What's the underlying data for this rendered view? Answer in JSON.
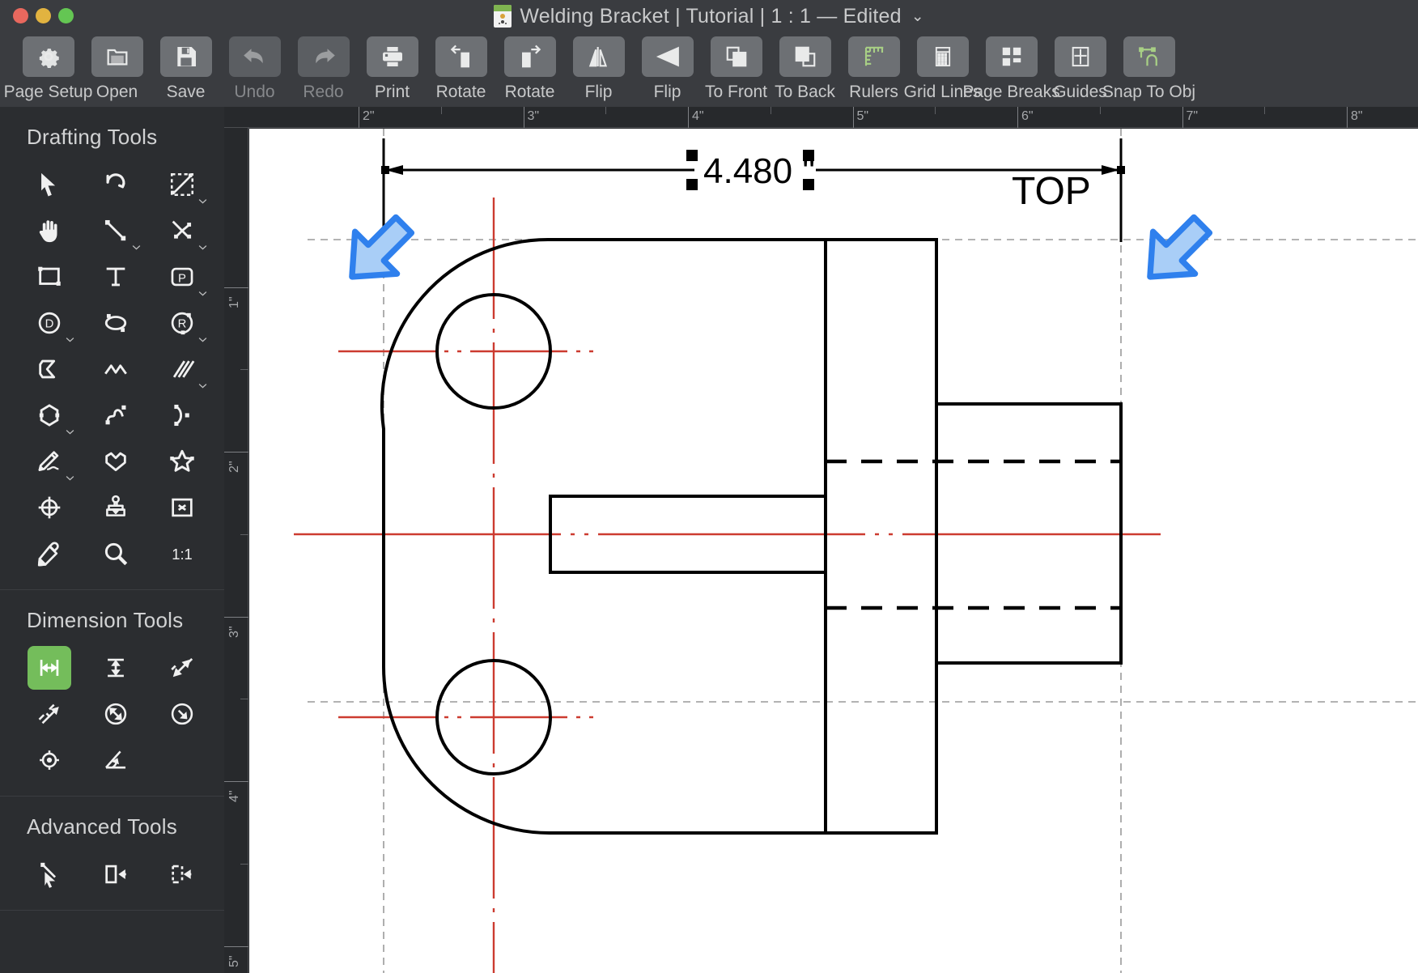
{
  "window": {
    "title": "Welding Bracket | Tutorial | 1 : 1 — Edited",
    "chevron": "⌄",
    "traffic_lights": [
      "close",
      "minimize",
      "zoom"
    ]
  },
  "toolbar": {
    "items": [
      {
        "label": "Page Setup",
        "icon": "gear-icon",
        "disabled": false
      },
      {
        "label": "Open",
        "icon": "folder-icon",
        "disabled": false
      },
      {
        "label": "Save",
        "icon": "floppy-disk-icon",
        "disabled": false
      },
      {
        "label": "Undo",
        "icon": "undo-arrow-icon",
        "disabled": true
      },
      {
        "label": "Redo",
        "icon": "redo-arrow-icon",
        "disabled": true
      },
      {
        "label": "Print",
        "icon": "printer-icon",
        "disabled": false
      },
      {
        "label": "Rotate",
        "icon": "rotate-left-icon",
        "disabled": false
      },
      {
        "label": "Rotate",
        "icon": "rotate-right-icon",
        "disabled": false
      },
      {
        "label": "Flip",
        "icon": "flip-vertical-icon",
        "disabled": false
      },
      {
        "label": "Flip",
        "icon": "flip-horizontal-icon",
        "disabled": false
      },
      {
        "label": "To Front",
        "icon": "bring-to-front-icon",
        "disabled": false
      },
      {
        "label": "To Back",
        "icon": "send-to-back-icon",
        "disabled": false
      },
      {
        "label": "Rulers",
        "icon": "ruler-icon",
        "disabled": false
      },
      {
        "label": "Grid Lines",
        "icon": "grid-lines-icon",
        "disabled": false
      },
      {
        "label": "Page Breaks",
        "icon": "page-breaks-icon",
        "disabled": false
      },
      {
        "label": "Guides",
        "icon": "guides-icon",
        "disabled": false
      },
      {
        "label": "Snap To Obj",
        "icon": "snap-to-object-icon",
        "disabled": false
      }
    ],
    "accent_green": "#a8cf85"
  },
  "sidebar": {
    "sections": [
      {
        "title": "Drafting Tools",
        "tools": [
          {
            "name": "select-arrow-tool",
            "caret": false,
            "active": false
          },
          {
            "name": "rotate-tool",
            "caret": false,
            "active": false
          },
          {
            "name": "scale-selection-tool",
            "caret": true,
            "active": false
          },
          {
            "name": "pan-hand-tool",
            "caret": false,
            "active": false
          },
          {
            "name": "line-tool",
            "caret": true,
            "active": false
          },
          {
            "name": "polyline-tool",
            "caret": true,
            "active": false
          },
          {
            "name": "rectangle-tool",
            "caret": false,
            "active": false
          },
          {
            "name": "text-tool",
            "caret": false,
            "active": false
          },
          {
            "name": "point-label-tool",
            "caret": true,
            "active": false
          },
          {
            "name": "diameter-circle-tool",
            "caret": true,
            "active": false
          },
          {
            "name": "ellipse-tool",
            "caret": false,
            "active": false
          },
          {
            "name": "radius-arc-tool",
            "caret": true,
            "active": false
          },
          {
            "name": "chamfer-tool",
            "caret": false,
            "active": false
          },
          {
            "name": "zigzag-tool",
            "caret": false,
            "active": false
          },
          {
            "name": "parallel-lines-tool",
            "caret": true,
            "active": false
          },
          {
            "name": "polygon-tool",
            "caret": true,
            "active": false
          },
          {
            "name": "spline-tool",
            "caret": false,
            "active": false
          },
          {
            "name": "arc-tool",
            "caret": false,
            "active": false
          },
          {
            "name": "freehand-pencil-tool",
            "caret": true,
            "active": false
          },
          {
            "name": "heart-shape-tool",
            "caret": false,
            "active": false
          },
          {
            "name": "star-shape-tool",
            "caret": false,
            "active": false
          },
          {
            "name": "center-mark-tool",
            "caret": false,
            "active": false
          },
          {
            "name": "stamp-tool",
            "caret": false,
            "active": false
          },
          {
            "name": "delete-tool",
            "caret": false,
            "active": false
          },
          {
            "name": "eyedropper-tool",
            "caret": false,
            "active": false
          },
          {
            "name": "zoom-tool",
            "caret": false,
            "active": false
          },
          {
            "name": "actual-size-tool",
            "caret": false,
            "active": false,
            "text": "1:1"
          }
        ]
      },
      {
        "title": "Dimension Tools",
        "tools": [
          {
            "name": "horizontal-dimension-tool",
            "caret": false,
            "active": true
          },
          {
            "name": "vertical-dimension-tool",
            "caret": false,
            "active": false
          },
          {
            "name": "aligned-dimension-tool",
            "caret": false,
            "active": false
          },
          {
            "name": "baseline-dimension-tool",
            "caret": false,
            "active": false
          },
          {
            "name": "diameter-dimension-tool",
            "caret": false,
            "active": false
          },
          {
            "name": "radius-dimension-tool",
            "caret": false,
            "active": false
          },
          {
            "name": "center-mark-dimension-tool",
            "caret": false,
            "active": false
          },
          {
            "name": "angular-dimension-tool",
            "caret": false,
            "active": false
          }
        ]
      },
      {
        "title": "Advanced Tools",
        "tools": [
          {
            "name": "node-edit-tool",
            "caret": false,
            "active": false
          },
          {
            "name": "align-left-tool",
            "caret": false,
            "active": false
          },
          {
            "name": "distribute-tool",
            "caret": false,
            "active": false
          }
        ]
      }
    ],
    "active_color": "#74bd5b"
  },
  "rulers": {
    "unit": "\"",
    "horizontal_labels": [
      "2\"",
      "3\"",
      "4\"",
      "5\"",
      "6\"",
      "7\""
    ],
    "vertical_labels": [
      "1\"",
      "2\"",
      "3\"",
      "4\""
    ]
  },
  "drawing": {
    "dimension_value": "4.480 \"",
    "view_label": "TOP",
    "selected": true,
    "handle_color": "#000000",
    "centerline_color": "#cc3b30",
    "guide_color": "#9a9a9a",
    "cursor_color": "#2f80ed",
    "cursor_fill": "#a9cef7",
    "outline_color": "#000000"
  }
}
